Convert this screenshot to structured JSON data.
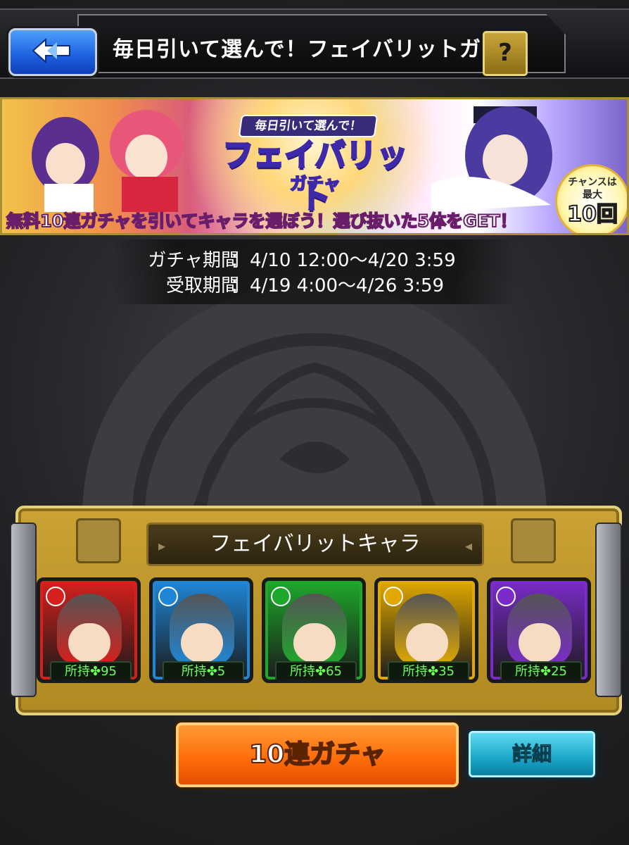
{
  "header": {
    "title": "毎日引いて選んで！フェイバリットガチャ",
    "help_label": "?"
  },
  "banner": {
    "logo_tag": "毎日引いて選んで！",
    "logo_main": "フェイバリット",
    "logo_sub": "ガチャ",
    "caption": "無料10連ガチャを引いてキャラを選ぼう！選び抜いた5体をGET！",
    "chance_line1": "チャンスは",
    "chance_line2": "最大",
    "chance_line3": "10回"
  },
  "periods": [
    {
      "label": "ガチャ期間",
      "colon": "：",
      "value": "4/10 12:00〜4/20 3:59"
    },
    {
      "label": "受取期間",
      "colon": "：",
      "value": "4/19 4:00〜4/26 3:59"
    }
  ],
  "favorite": {
    "title": "フェイバリットキャラ",
    "characters": [
      {
        "element": "fire",
        "color": "#d6201c",
        "owned": "所持✤95"
      },
      {
        "element": "water",
        "color": "#1f86d6",
        "owned": "所持✤5"
      },
      {
        "element": "wood",
        "color": "#1ea82b",
        "owned": "所持✤65"
      },
      {
        "element": "light",
        "color": "#e0a800",
        "owned": "所持✤35"
      },
      {
        "element": "dark",
        "color": "#7a2bc9",
        "owned": "所持✤25"
      }
    ]
  },
  "buttons": {
    "gacha": "10連ガチャ",
    "detail": "詳細"
  }
}
